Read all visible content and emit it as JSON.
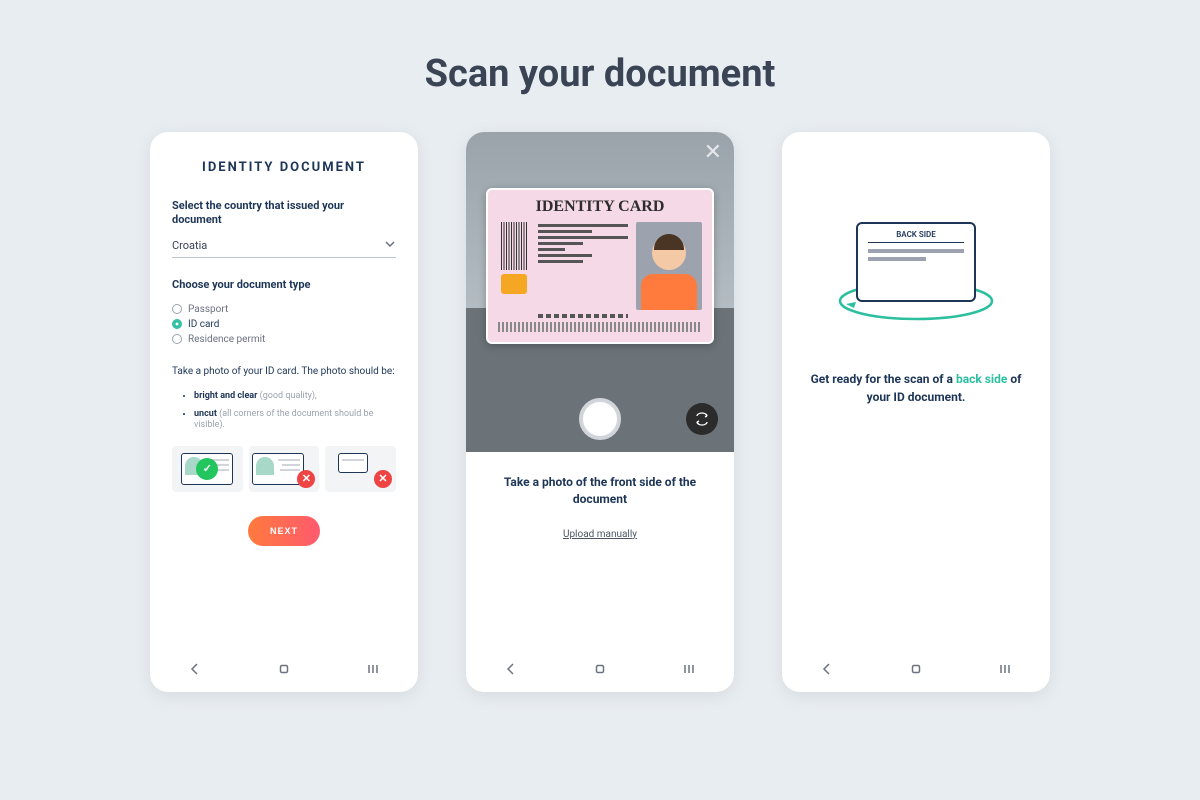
{
  "page": {
    "title": "Scan your document"
  },
  "phone1": {
    "heading": "IDENTITY DOCUMENT",
    "country_label": "Select the country that issued your document",
    "country_value": "Croatia",
    "doctype_label": "Choose your document type",
    "doctypes": [
      {
        "label": "Passport",
        "selected": false
      },
      {
        "label": "ID card",
        "selected": true
      },
      {
        "label": "Residence permit",
        "selected": false
      }
    ],
    "photo_instruction": "Take a photo of your ID card. The photo should be:",
    "bullets": [
      {
        "strong": "bright and clear",
        "muted": "(good quality),"
      },
      {
        "strong": "uncut",
        "muted": "(all corners of the document should be visible)."
      }
    ],
    "next_button": "NEXT"
  },
  "phone2": {
    "card_title": "IDENTITY CARD",
    "instruction": "Take a photo of the front side of the document",
    "upload_link": "Upload manually"
  },
  "phone3": {
    "card_label": "BACK SIDE",
    "text_before": "Get ready for the scan of a ",
    "text_highlight": "back side",
    "text_after": " of your ID document."
  }
}
